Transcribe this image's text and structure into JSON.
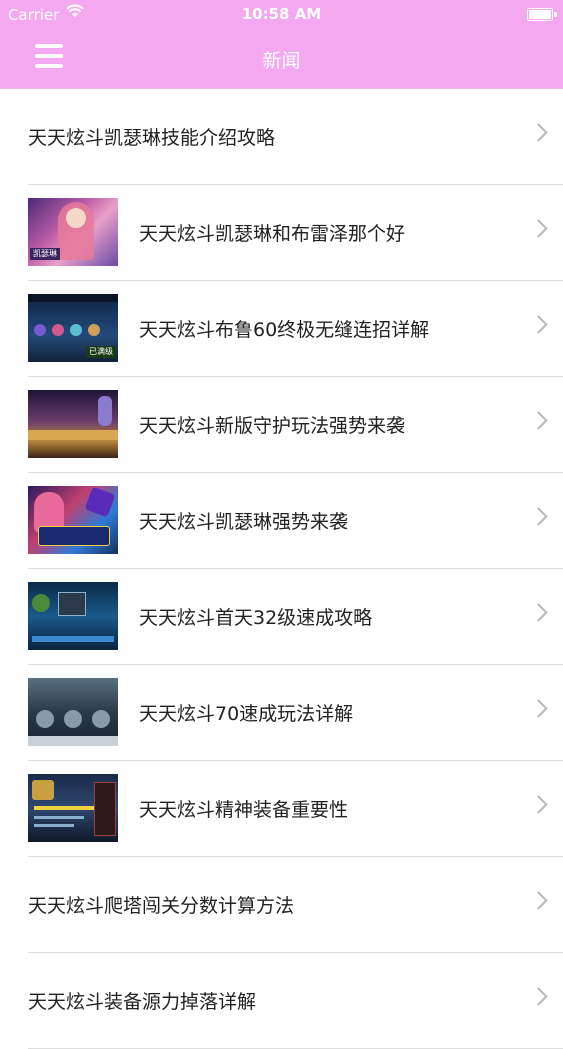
{
  "status_bar": {
    "carrier": "Carrier",
    "time": "10:58 AM",
    "wifi_icon": "wifi-icon",
    "battery_icon": "battery-icon"
  },
  "nav_bar": {
    "title": "新闻",
    "menu_icon": "hamburger-menu-icon",
    "background_color": "#f4a8f0"
  },
  "news_list": [
    {
      "title": "天天炫斗凯瑟琳技能介绍攻略",
      "has_thumbnail": false
    },
    {
      "title": "天天炫斗凯瑟琳和布雷泽那个好",
      "has_thumbnail": true,
      "thumbnail_label": "凯瑟琳"
    },
    {
      "title": "天天炫斗布鲁60终极无缝连招详解",
      "has_thumbnail": true,
      "thumbnail_label": "已满级"
    },
    {
      "title": "天天炫斗新版守护玩法强势来袭",
      "has_thumbnail": true
    },
    {
      "title": "天天炫斗凯瑟琳强势来袭",
      "has_thumbnail": true
    },
    {
      "title": "天天炫斗首天32级速成攻略",
      "has_thumbnail": true
    },
    {
      "title": "天天炫斗70速成玩法详解",
      "has_thumbnail": true
    },
    {
      "title": "天天炫斗精神装备重要性",
      "has_thumbnail": true
    },
    {
      "title": "天天炫斗爬塔闯关分数计算方法",
      "has_thumbnail": false
    },
    {
      "title": "天天炫斗装备源力掉落详解",
      "has_thumbnail": false
    }
  ],
  "row_chevron_icon": "chevron-right-icon"
}
